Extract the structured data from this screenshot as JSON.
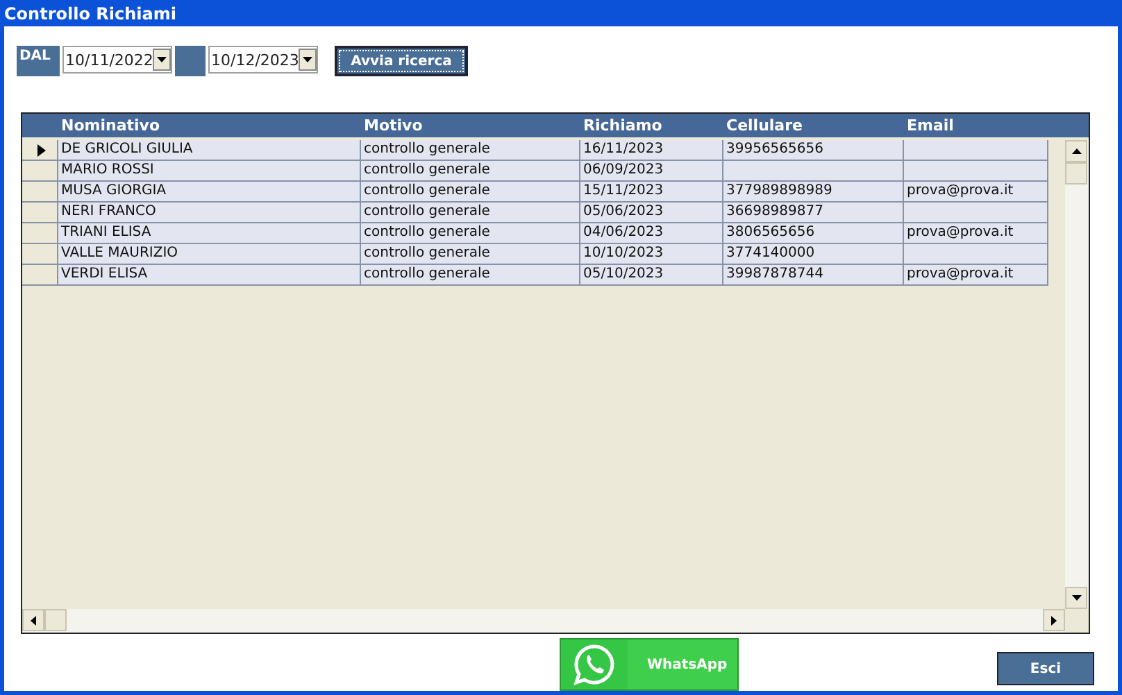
{
  "window": {
    "title": "Controllo Richiami"
  },
  "filter": {
    "from_label": "DAL",
    "from_date": "10/11/2022",
    "to_date": "10/12/2023",
    "search_button": "Avvia ricerca"
  },
  "table": {
    "columns": [
      "Nominativo",
      "Motivo",
      "Richiamo",
      "Cellulare",
      "Email"
    ],
    "rows": [
      {
        "selected": true,
        "cells": [
          "DE GRICOLI GIULIA",
          "controllo generale",
          "16/11/2023",
          "39956565656",
          ""
        ]
      },
      {
        "selected": false,
        "cells": [
          "MARIO ROSSI",
          "controllo generale",
          "06/09/2023",
          "",
          ""
        ]
      },
      {
        "selected": false,
        "cells": [
          "MUSA GIORGIA",
          "controllo generale",
          "15/11/2023",
          "377989898989",
          "prova@prova.it"
        ]
      },
      {
        "selected": false,
        "cells": [
          "NERI FRANCO",
          "controllo generale",
          "05/06/2023",
          "36698989877",
          ""
        ]
      },
      {
        "selected": false,
        "cells": [
          "TRIANI ELISA",
          "controllo generale",
          "04/06/2023",
          "3806565656",
          "prova@prova.it"
        ]
      },
      {
        "selected": false,
        "cells": [
          "VALLE MAURIZIO",
          "controllo generale",
          "10/10/2023",
          "3774140000",
          ""
        ]
      },
      {
        "selected": false,
        "cells": [
          "VERDI ELISA",
          "controllo generale",
          "05/10/2023",
          "39987878744",
          "prova@prova.it"
        ]
      }
    ]
  },
  "buttons": {
    "whatsapp": "WhatsApp",
    "exit": "Esci"
  }
}
